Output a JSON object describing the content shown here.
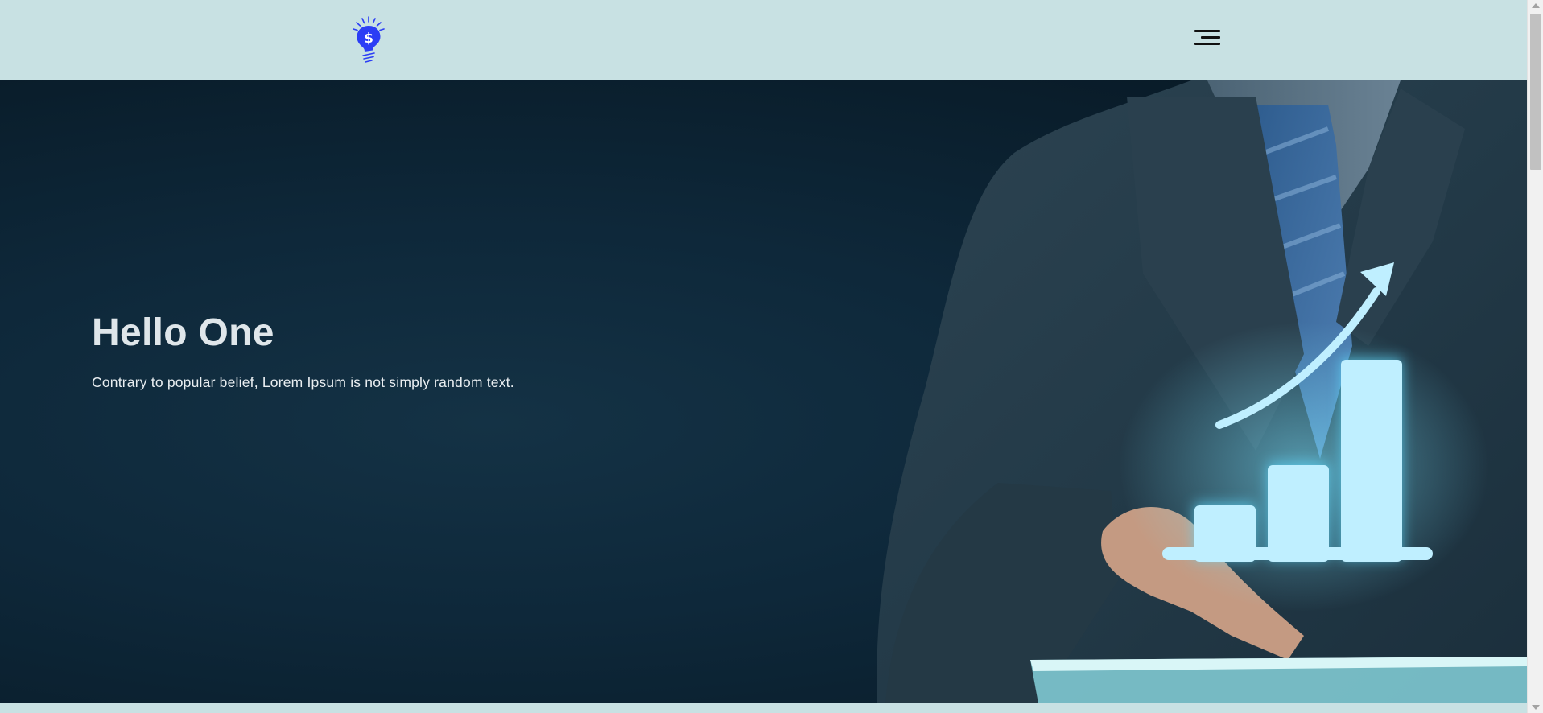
{
  "header": {
    "logo_icon": "lightbulb-dollar-icon",
    "menu_icon": "hamburger-menu-icon"
  },
  "hero": {
    "title": "Hello One",
    "subtitle": "Contrary to popular belief, Lorem Ipsum is not simply random text.",
    "image": "businessman-growth-chart-tablet"
  },
  "colors": {
    "header_bg": "#c8e1e3",
    "logo_blue": "#2b3df5",
    "hero_bg": "#0e283a",
    "hero_title": "#dfe6ea",
    "hero_subtitle": "#e9eef1",
    "chart_glow": "#bfefff"
  }
}
